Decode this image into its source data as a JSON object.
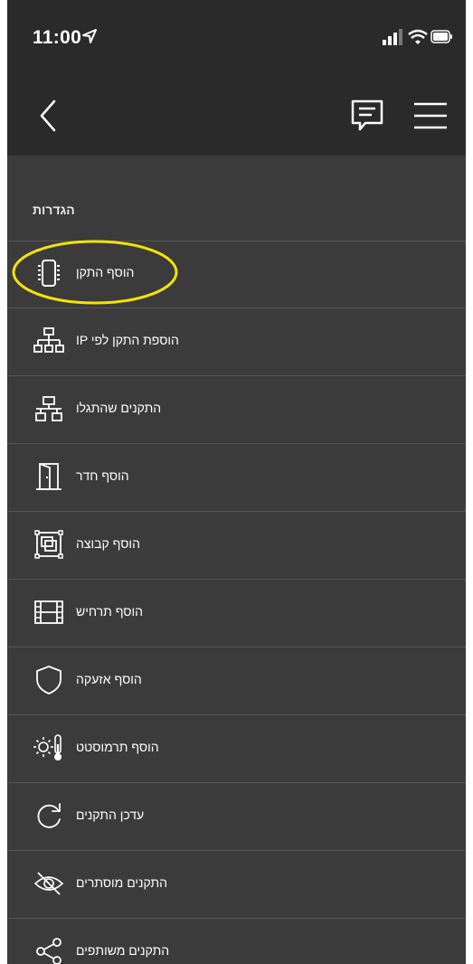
{
  "status_bar": {
    "time": "11:00",
    "location_icon": "location-arrow-icon",
    "signal_icon": "signal-bars-icon",
    "wifi_icon": "wifi-icon",
    "battery_icon": "battery-icon"
  },
  "nav": {
    "back_icon": "chevron-left-icon",
    "chat_icon": "message-square-icon",
    "menu_icon": "hamburger-menu-icon"
  },
  "section": {
    "title": "הגדרות"
  },
  "menu": {
    "items": [
      {
        "label": "הוסף התקן",
        "icon": "device-chip-icon"
      },
      {
        "label": "IP הוספת התקן לפי",
        "icon": "network-tree-icon"
      },
      {
        "label": "התקנים שהתגלו",
        "icon": "network-discover-icon"
      },
      {
        "label": "הוסף חדר",
        "icon": "door-icon"
      },
      {
        "label": "הוסף קבוצה",
        "icon": "group-square-icon"
      },
      {
        "label": "הוסף תרחיש",
        "icon": "film-strip-icon"
      },
      {
        "label": "הוסף אזעקה",
        "icon": "shield-icon"
      },
      {
        "label": "הוסף תרמוסטט",
        "icon": "thermostat-icon"
      },
      {
        "label": "עדכן התקנים",
        "icon": "refresh-icon"
      },
      {
        "label": "התקנים מוסתרים",
        "icon": "eye-hidden-icon"
      },
      {
        "label": "התקנים משותפים",
        "icon": "share-icon"
      }
    ]
  },
  "colors": {
    "background": "#3b3b3b",
    "header_background": "#2a2a2a",
    "divider": "#555555",
    "text": "#ffffff",
    "highlight": "#f5e300"
  }
}
